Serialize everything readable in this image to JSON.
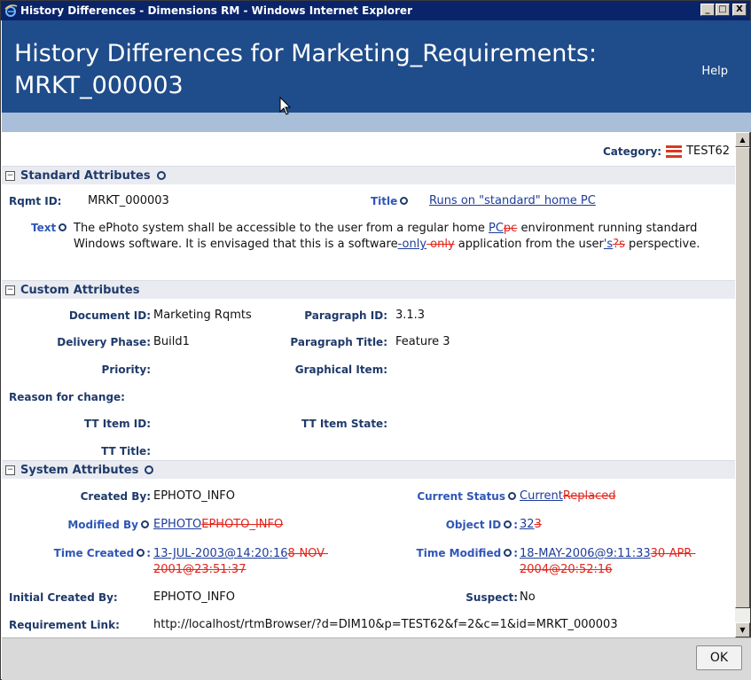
{
  "window": {
    "title": "History Differences - Dimensions RM - Windows Internet Explorer",
    "minimize": "_",
    "maximize": "□",
    "close": "X"
  },
  "header": {
    "title_line1": "History Differences for Marketing_Requirements:",
    "title_line2": "MRKT_000003",
    "help": "Help"
  },
  "category": {
    "label": "Category:",
    "value": "TEST62"
  },
  "standard": {
    "heading": "Standard Attributes",
    "rqmt_id_label": "Rqmt ID:",
    "rqmt_id_value": "MRKT_000003",
    "title_label": "Title",
    "title_value": "Runs on \"standard\" home PC",
    "text_label": "Text",
    "text_part1": "The ePhoto system shall be accessible to the user from a regular home ",
    "text_ins1": "PC",
    "text_del1": "pc",
    "text_part2": " environment running standard Windows software. It is envisaged that this is a software",
    "text_ins2": "-only",
    "text_del2": " only",
    "text_part3": " application from the user",
    "text_ins3": "'s",
    "text_del3": "?s",
    "text_part4": " perspective."
  },
  "custom": {
    "heading": "Custom Attributes",
    "document_id_label": "Document ID:",
    "document_id_value": "Marketing Rqmts",
    "paragraph_id_label": "Paragraph ID:",
    "paragraph_id_value": "3.1.3",
    "delivery_phase_label": "Delivery Phase:",
    "delivery_phase_value": "Build1",
    "paragraph_title_label": "Paragraph Title:",
    "paragraph_title_value": "Feature 3",
    "priority_label": "Priority:",
    "graphical_item_label": "Graphical Item:",
    "reason_label": "Reason for change:",
    "tt_item_id_label": "TT Item ID:",
    "tt_item_state_label": "TT Item State:",
    "tt_title_label": "TT Title:"
  },
  "system": {
    "heading": "System Attributes",
    "created_by_label": "Created By:",
    "created_by_value": "EPHOTO_INFO",
    "current_status_label": "Current Status",
    "current_status_new": "Current",
    "current_status_old": "Replaced",
    "modified_by_label": "Modified By",
    "modified_by_new": "EPHOTO",
    "modified_by_old": "EPHOTO_INFO",
    "object_id_label": "Object ID",
    "object_id_new": "32",
    "object_id_old": "3",
    "time_created_label": "Time Created",
    "time_created_new": "13-JUL-2003@14:20:16",
    "time_created_old1": "8-NOV-",
    "time_created_old2": "2001@23:51:37",
    "time_modified_label": "Time Modified",
    "time_modified_new": "18-MAY-2006@9:11:33",
    "time_modified_old1": "30-APR-",
    "time_modified_old2": "2004@20:52:16",
    "initial_created_label": "Initial Created By:",
    "initial_created_value": "EPHOTO_INFO",
    "suspect_label": "Suspect:",
    "suspect_value": "No",
    "req_link_label": "Requirement Link:",
    "req_link_value": "http://localhost/rtmBrowser/?d=DIM10&p=TEST62&f=2&c=1&id=MRKT_000003"
  },
  "footer": {
    "ok": "OK"
  },
  "colors": {
    "titlebar": "#0a246a",
    "banner": "#1f4c8a",
    "label": "#1f3a6a",
    "deleted": "#e1251b",
    "link": "#1d3c9a"
  }
}
